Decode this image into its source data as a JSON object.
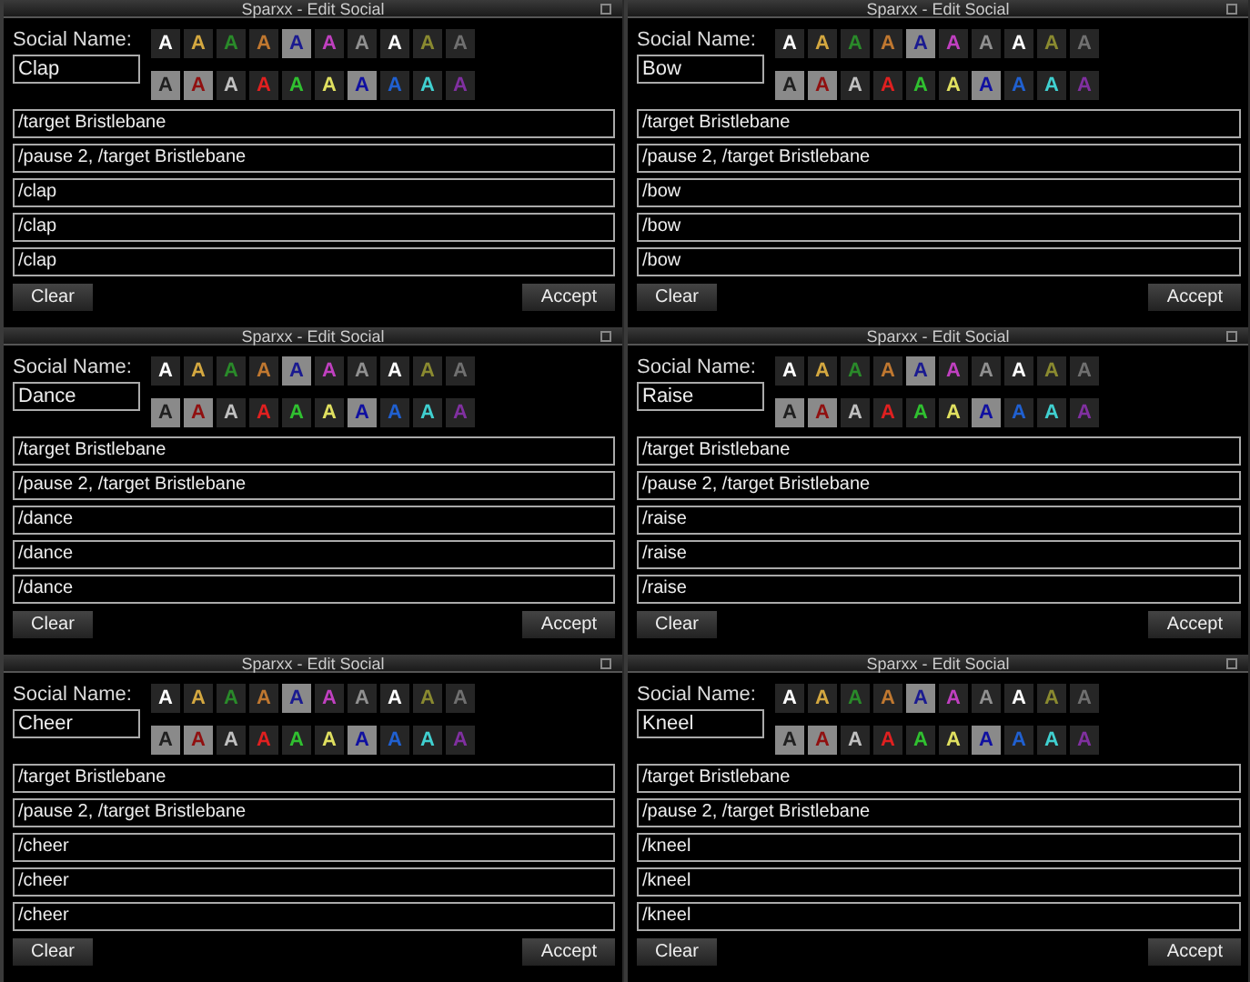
{
  "panels": [
    {
      "title": "Sparxx - Edit Social",
      "name_label": "Social Name:",
      "name": "Clap",
      "lines": [
        "/target Bristlebane",
        "/pause 2, /target Bristlebane",
        "/clap",
        "/clap",
        "/clap"
      ],
      "clear": "Clear",
      "accept": "Accept",
      "swatches": [
        {
          "label": "A",
          "color": "#ffffff"
        },
        {
          "label": "A",
          "color": "#d4a840"
        },
        {
          "label": "A",
          "color": "#2a8a2a"
        },
        {
          "label": "A",
          "color": "#c07830"
        },
        {
          "label": "A",
          "color": "#1a1a90"
        },
        {
          "label": "A",
          "color": "#c040c0"
        },
        {
          "label": "A",
          "color": "#909090"
        },
        {
          "label": "A",
          "color": "#ffffff"
        },
        {
          "label": "A",
          "color": "#8a8a30"
        },
        {
          "label": "A",
          "color": "#707070"
        },
        {
          "label": "A",
          "color": "#202020"
        },
        {
          "label": "A",
          "color": "#901010"
        },
        {
          "label": "A",
          "color": "#c0c0c0"
        },
        {
          "label": "A",
          "color": "#e02020"
        },
        {
          "label": "A",
          "color": "#30c030"
        },
        {
          "label": "A",
          "color": "#e0e060"
        },
        {
          "label": "A",
          "color": "#1010a0"
        },
        {
          "label": "A",
          "color": "#2060d0"
        },
        {
          "label": "A",
          "color": "#40d0d0"
        },
        {
          "label": "A",
          "color": "#8030a0"
        }
      ]
    },
    {
      "title": "Sparxx - Edit Social",
      "name_label": "Social Name:",
      "name": "Bow",
      "lines": [
        "/target Bristlebane",
        "/pause 2, /target Bristlebane",
        "/bow",
        "/bow",
        "/bow"
      ],
      "clear": "Clear",
      "accept": "Accept",
      "swatches": [
        {
          "label": "A",
          "color": "#ffffff"
        },
        {
          "label": "A",
          "color": "#d4a840"
        },
        {
          "label": "A",
          "color": "#2a8a2a"
        },
        {
          "label": "A",
          "color": "#c07830"
        },
        {
          "label": "A",
          "color": "#1a1a90"
        },
        {
          "label": "A",
          "color": "#c040c0"
        },
        {
          "label": "A",
          "color": "#909090"
        },
        {
          "label": "A",
          "color": "#ffffff"
        },
        {
          "label": "A",
          "color": "#8a8a30"
        },
        {
          "label": "A",
          "color": "#707070"
        },
        {
          "label": "A",
          "color": "#202020"
        },
        {
          "label": "A",
          "color": "#901010"
        },
        {
          "label": "A",
          "color": "#c0c0c0"
        },
        {
          "label": "A",
          "color": "#e02020"
        },
        {
          "label": "A",
          "color": "#30c030"
        },
        {
          "label": "A",
          "color": "#e0e060"
        },
        {
          "label": "A",
          "color": "#1010a0"
        },
        {
          "label": "A",
          "color": "#2060d0"
        },
        {
          "label": "A",
          "color": "#40d0d0"
        },
        {
          "label": "A",
          "color": "#8030a0"
        }
      ]
    },
    {
      "title": "Sparxx - Edit Social",
      "name_label": "Social Name:",
      "name": "Dance",
      "lines": [
        "/target Bristlebane",
        "/pause 2, /target Bristlebane",
        "/dance",
        "/dance",
        "/dance"
      ],
      "clear": "Clear",
      "accept": "Accept",
      "swatches": [
        {
          "label": "A",
          "color": "#ffffff"
        },
        {
          "label": "A",
          "color": "#d4a840"
        },
        {
          "label": "A",
          "color": "#2a8a2a"
        },
        {
          "label": "A",
          "color": "#c07830"
        },
        {
          "label": "A",
          "color": "#1a1a90"
        },
        {
          "label": "A",
          "color": "#c040c0"
        },
        {
          "label": "A",
          "color": "#909090"
        },
        {
          "label": "A",
          "color": "#ffffff"
        },
        {
          "label": "A",
          "color": "#8a8a30"
        },
        {
          "label": "A",
          "color": "#707070"
        },
        {
          "label": "A",
          "color": "#202020"
        },
        {
          "label": "A",
          "color": "#901010"
        },
        {
          "label": "A",
          "color": "#c0c0c0"
        },
        {
          "label": "A",
          "color": "#e02020"
        },
        {
          "label": "A",
          "color": "#30c030"
        },
        {
          "label": "A",
          "color": "#e0e060"
        },
        {
          "label": "A",
          "color": "#1010a0"
        },
        {
          "label": "A",
          "color": "#2060d0"
        },
        {
          "label": "A",
          "color": "#40d0d0"
        },
        {
          "label": "A",
          "color": "#8030a0"
        }
      ]
    },
    {
      "title": "Sparxx - Edit Social",
      "name_label": "Social Name:",
      "name": "Raise",
      "lines": [
        "/target Bristlebane",
        "/pause 2, /target Bristlebane",
        "/raise",
        "/raise",
        "/raise"
      ],
      "clear": "Clear",
      "accept": "Accept",
      "swatches": [
        {
          "label": "A",
          "color": "#ffffff"
        },
        {
          "label": "A",
          "color": "#d4a840"
        },
        {
          "label": "A",
          "color": "#2a8a2a"
        },
        {
          "label": "A",
          "color": "#c07830"
        },
        {
          "label": "A",
          "color": "#1a1a90"
        },
        {
          "label": "A",
          "color": "#c040c0"
        },
        {
          "label": "A",
          "color": "#909090"
        },
        {
          "label": "A",
          "color": "#ffffff"
        },
        {
          "label": "A",
          "color": "#8a8a30"
        },
        {
          "label": "A",
          "color": "#707070"
        },
        {
          "label": "A",
          "color": "#202020"
        },
        {
          "label": "A",
          "color": "#901010"
        },
        {
          "label": "A",
          "color": "#c0c0c0"
        },
        {
          "label": "A",
          "color": "#e02020"
        },
        {
          "label": "A",
          "color": "#30c030"
        },
        {
          "label": "A",
          "color": "#e0e060"
        },
        {
          "label": "A",
          "color": "#1010a0"
        },
        {
          "label": "A",
          "color": "#2060d0"
        },
        {
          "label": "A",
          "color": "#40d0d0"
        },
        {
          "label": "A",
          "color": "#8030a0"
        }
      ]
    },
    {
      "title": "Sparxx - Edit Social",
      "name_label": "Social Name:",
      "name": "Cheer",
      "lines": [
        "/target Bristlebane",
        "/pause 2, /target Bristlebane",
        "/cheer",
        "/cheer",
        "/cheer"
      ],
      "clear": "Clear",
      "accept": "Accept",
      "swatches": [
        {
          "label": "A",
          "color": "#ffffff"
        },
        {
          "label": "A",
          "color": "#d4a840"
        },
        {
          "label": "A",
          "color": "#2a8a2a"
        },
        {
          "label": "A",
          "color": "#c07830"
        },
        {
          "label": "A",
          "color": "#1a1a90"
        },
        {
          "label": "A",
          "color": "#c040c0"
        },
        {
          "label": "A",
          "color": "#909090"
        },
        {
          "label": "A",
          "color": "#ffffff"
        },
        {
          "label": "A",
          "color": "#8a8a30"
        },
        {
          "label": "A",
          "color": "#707070"
        },
        {
          "label": "A",
          "color": "#202020"
        },
        {
          "label": "A",
          "color": "#901010"
        },
        {
          "label": "A",
          "color": "#c0c0c0"
        },
        {
          "label": "A",
          "color": "#e02020"
        },
        {
          "label": "A",
          "color": "#30c030"
        },
        {
          "label": "A",
          "color": "#e0e060"
        },
        {
          "label": "A",
          "color": "#1010a0"
        },
        {
          "label": "A",
          "color": "#2060d0"
        },
        {
          "label": "A",
          "color": "#40d0d0"
        },
        {
          "label": "A",
          "color": "#8030a0"
        }
      ]
    },
    {
      "title": "Sparxx - Edit Social",
      "name_label": "Social Name:",
      "name": "Kneel",
      "lines": [
        "/target Bristlebane",
        "/pause 2, /target Bristlebane",
        "/kneel",
        "/kneel",
        "/kneel"
      ],
      "clear": "Clear",
      "accept": "Accept",
      "swatches": [
        {
          "label": "A",
          "color": "#ffffff"
        },
        {
          "label": "A",
          "color": "#d4a840"
        },
        {
          "label": "A",
          "color": "#2a8a2a"
        },
        {
          "label": "A",
          "color": "#c07830"
        },
        {
          "label": "A",
          "color": "#1a1a90"
        },
        {
          "label": "A",
          "color": "#c040c0"
        },
        {
          "label": "A",
          "color": "#909090"
        },
        {
          "label": "A",
          "color": "#ffffff"
        },
        {
          "label": "A",
          "color": "#8a8a30"
        },
        {
          "label": "A",
          "color": "#707070"
        },
        {
          "label": "A",
          "color": "#202020"
        },
        {
          "label": "A",
          "color": "#901010"
        },
        {
          "label": "A",
          "color": "#c0c0c0"
        },
        {
          "label": "A",
          "color": "#e02020"
        },
        {
          "label": "A",
          "color": "#30c030"
        },
        {
          "label": "A",
          "color": "#e0e060"
        },
        {
          "label": "A",
          "color": "#1010a0"
        },
        {
          "label": "A",
          "color": "#2060d0"
        },
        {
          "label": "A",
          "color": "#40d0d0"
        },
        {
          "label": "A",
          "color": "#8030a0"
        }
      ]
    }
  ]
}
